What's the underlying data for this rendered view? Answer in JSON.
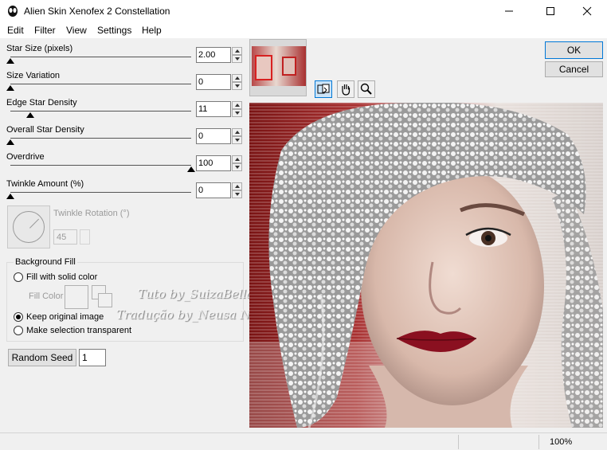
{
  "window": {
    "title": "Alien Skin Xenofex 2 Constellation"
  },
  "menu": [
    "Edit",
    "Filter",
    "View",
    "Settings",
    "Help"
  ],
  "params": [
    {
      "label": "Star Size (pixels)",
      "value": "2.00",
      "level": 0.0
    },
    {
      "label": "Size Variation",
      "value": "0",
      "level": 0.0
    },
    {
      "label": "Edge Star Density",
      "value": "11",
      "level": 0.11
    },
    {
      "label": "Overall Star Density",
      "value": "0",
      "level": 0.0
    },
    {
      "label": "Overdrive",
      "value": "100",
      "level": 1.0
    },
    {
      "label": "Twinkle Amount (%)",
      "value": "0",
      "level": 0.0
    }
  ],
  "twinkle_rotation": {
    "label": "Twinkle Rotation (°)",
    "value": "45"
  },
  "background_fill": {
    "title": "Background Fill",
    "option_solid": "Fill with solid color",
    "fill_color_label": "Fill Color",
    "option_keep": "Keep original image",
    "option_transparent": "Make selection transparent",
    "selected": "keep"
  },
  "random_seed": {
    "button": "Random Seed",
    "value": "1"
  },
  "buttons": {
    "ok": "OK",
    "cancel": "Cancel"
  },
  "watermark": {
    "line1": "Tuto by_SuizaBella",
    "line2": "Tradução by_Neusa Novaes"
  },
  "status": {
    "zoom": "100%"
  },
  "icons": {
    "app": "alien-head-icon",
    "minimize": "minimize-icon",
    "maximize": "maximize-icon",
    "close": "close-icon",
    "compare": "compare-icon",
    "hand": "hand-icon",
    "zoom": "zoom-icon"
  },
  "colors": {
    "accent": "#0078d7",
    "preview_bg": "#8a1a1a"
  }
}
